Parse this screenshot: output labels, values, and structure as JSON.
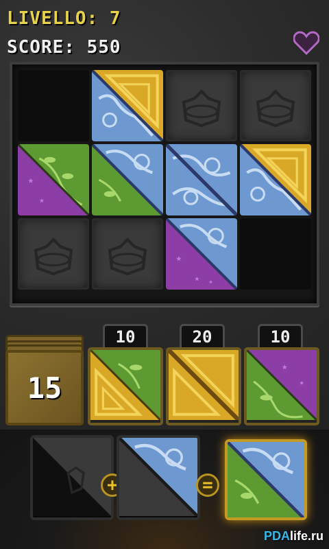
{
  "hud": {
    "level_label": "LIVELLO:",
    "level_value": "7",
    "score_label": "SCORE:",
    "score_value": "550"
  },
  "deck": {
    "count": "15"
  },
  "offers": [
    {
      "price": "10"
    },
    {
      "price": "20"
    },
    {
      "price": "10"
    }
  ],
  "operators": {
    "plus": "+",
    "equals": "="
  },
  "watermark": {
    "pda": "PDA",
    "site": "life.ru"
  },
  "colors": {
    "gold": "#e0b12a",
    "blue": "#6f9ad2",
    "green": "#5e9a32",
    "purple": "#8d3da6",
    "stone": "#3a3a3a"
  }
}
